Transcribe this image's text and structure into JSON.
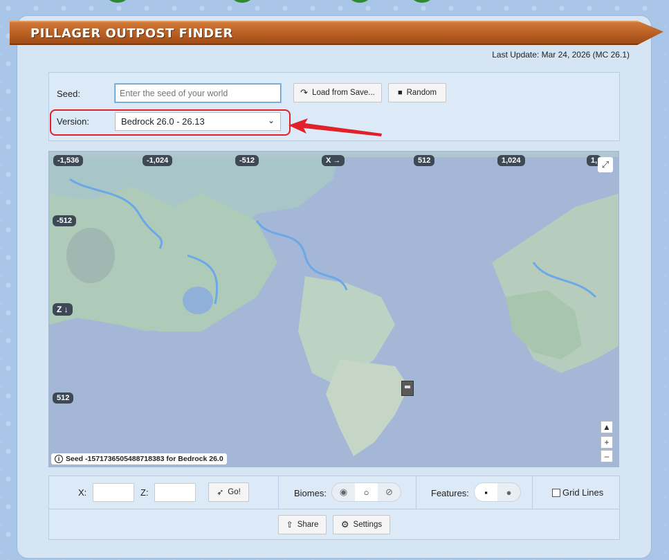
{
  "header": {
    "title": "PILLAGER OUTPOST FINDER",
    "last_update": "Last Update: Mar 24, 2026 (MC 26.1)"
  },
  "form": {
    "seed_label": "Seed:",
    "seed_placeholder": "Enter the seed of your world",
    "load_button": "Load from Save...",
    "random_button": "Random",
    "version_label": "Version:",
    "version_selected": "Bedrock 26.0 - 26.13"
  },
  "map": {
    "x_ticks": [
      "-1,536",
      "-1,024",
      "-512",
      "X →",
      "512",
      "1,024",
      "1,"
    ],
    "z_ticks": [
      "-512",
      "Z ↓",
      "512"
    ],
    "seed_info": "Seed -1571736505488718383 for Bedrock 26.0",
    "controls": {
      "north": "▲",
      "zoom_in": "+",
      "zoom_out": "–"
    },
    "icons": {
      "fullscreen": "expand-icon",
      "info": "info-icon",
      "outpost": "pillager-outpost-icon"
    }
  },
  "controls": {
    "x_label": "X:",
    "z_label": "Z:",
    "go_button": "Go!",
    "biomes_label": "Biomes:",
    "features_label": "Features:",
    "grid_lines_label": "Grid Lines",
    "share_button": "Share",
    "settings_button": "Settings"
  },
  "colors": {
    "accent_red": "#e0202a",
    "banner": "#b85e22",
    "panel": "#d5e5f4"
  }
}
